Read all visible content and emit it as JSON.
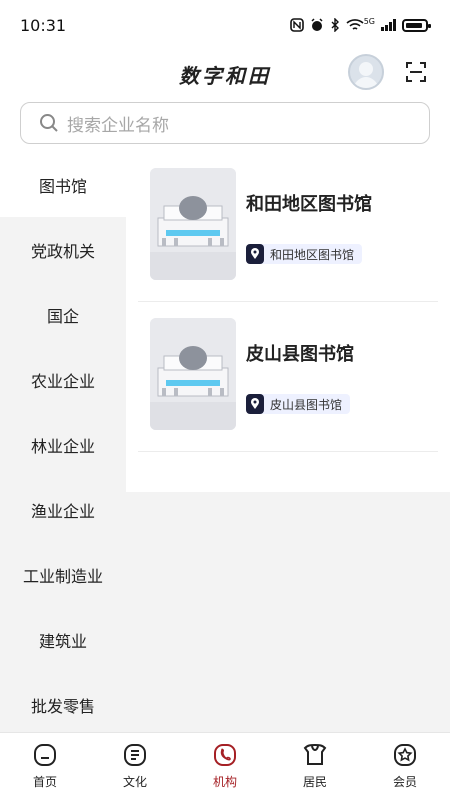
{
  "status_bar": {
    "time": "10:31",
    "network": "5G"
  },
  "header": {
    "title": "数字和田"
  },
  "search": {
    "placeholder": "搜索企业名称"
  },
  "sidebar": {
    "items": [
      {
        "label": "图书馆",
        "active": true
      },
      {
        "label": "党政机关",
        "active": false
      },
      {
        "label": "国企",
        "active": false
      },
      {
        "label": "农业企业",
        "active": false
      },
      {
        "label": "林业企业",
        "active": false
      },
      {
        "label": "渔业企业",
        "active": false
      },
      {
        "label": "工业制造业",
        "active": false
      },
      {
        "label": "建筑业",
        "active": false
      },
      {
        "label": "批发零售",
        "active": false
      }
    ]
  },
  "list": {
    "items": [
      {
        "title": "和田地区图书馆",
        "tag": "和田地区图书馆"
      },
      {
        "title": "皮山县图书馆",
        "tag": "皮山县图书馆"
      }
    ]
  },
  "bottom_nav": {
    "items": [
      {
        "label": "首页",
        "icon": "home-icon"
      },
      {
        "label": "文化",
        "icon": "culture-icon"
      },
      {
        "label": "机构",
        "icon": "institution-icon",
        "active": true
      },
      {
        "label": "居民",
        "icon": "resident-icon"
      },
      {
        "label": "会员",
        "icon": "member-icon"
      }
    ]
  },
  "colors": {
    "accent": "#a52025",
    "sidebar_bg": "#f3f3f3",
    "tag_bg": "#eef1ff"
  }
}
